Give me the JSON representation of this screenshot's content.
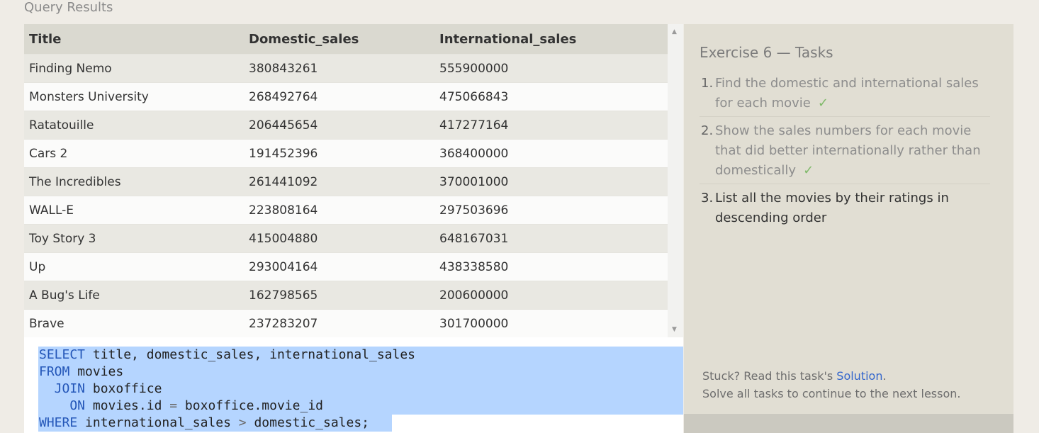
{
  "query_results": {
    "label": "Query Results",
    "columns": [
      "Title",
      "Domestic_sales",
      "International_sales"
    ],
    "rows": [
      [
        "Finding Nemo",
        "380843261",
        "555900000"
      ],
      [
        "Monsters University",
        "268492764",
        "475066843"
      ],
      [
        "Ratatouille",
        "206445654",
        "417277164"
      ],
      [
        "Cars 2",
        "191452396",
        "368400000"
      ],
      [
        "The Incredibles",
        "261441092",
        "370001000"
      ],
      [
        "WALL-E",
        "223808164",
        "297503696"
      ],
      [
        "Toy Story 3",
        "415004880",
        "648167031"
      ],
      [
        "Up",
        "293004164",
        "438338580"
      ],
      [
        "A Bug's Life",
        "162798565",
        "200600000"
      ],
      [
        "Brave",
        "237283207",
        "301700000"
      ]
    ]
  },
  "editor": {
    "lines": [
      [
        {
          "t": "SELECT",
          "c": "kw"
        },
        {
          "t": " title, domestic_sales, international_sales",
          "c": ""
        }
      ],
      [
        {
          "t": "FROM",
          "c": "kw"
        },
        {
          "t": " movies",
          "c": ""
        }
      ],
      [
        {
          "t": "  JOIN",
          "c": "kw"
        },
        {
          "t": " boxoffice",
          "c": ""
        }
      ],
      [
        {
          "t": "    ON",
          "c": "kw"
        },
        {
          "t": " movies.id ",
          "c": ""
        },
        {
          "t": "=",
          "c": "op"
        },
        {
          "t": " boxoffice.movie_id",
          "c": ""
        }
      ],
      [
        {
          "t": "WHERE",
          "c": "kw"
        },
        {
          "t": " international_sales ",
          "c": ""
        },
        {
          "t": ">",
          "c": "op"
        },
        {
          "t": " domestic_sales;",
          "c": ""
        }
      ]
    ]
  },
  "tasks": {
    "title": "Exercise 6 — Tasks",
    "items": [
      {
        "num": "1.",
        "text": "Find the domestic and international sales for each movie",
        "done": true,
        "check": "✓"
      },
      {
        "num": "2.",
        "text": "Show the sales numbers for each movie that did better internationally rather than domestically",
        "done": true,
        "check": "✓"
      },
      {
        "num": "3.",
        "text": "List all the movies by their ratings in descending order",
        "done": false,
        "check": ""
      }
    ],
    "stuck_prefix": "Stuck? Read this task's ",
    "solution_link": "Solution",
    "stuck_suffix": ".",
    "continue_text": "Solve all tasks to continue to the next lesson."
  },
  "icons": {
    "scroll_up": "scroll-up-arrow",
    "scroll_down": "scroll-down-arrow"
  },
  "colors": {
    "keyword": "#2356b8",
    "selection": "#b5d5ff",
    "check": "#7fba6a",
    "link": "#3366cc"
  }
}
